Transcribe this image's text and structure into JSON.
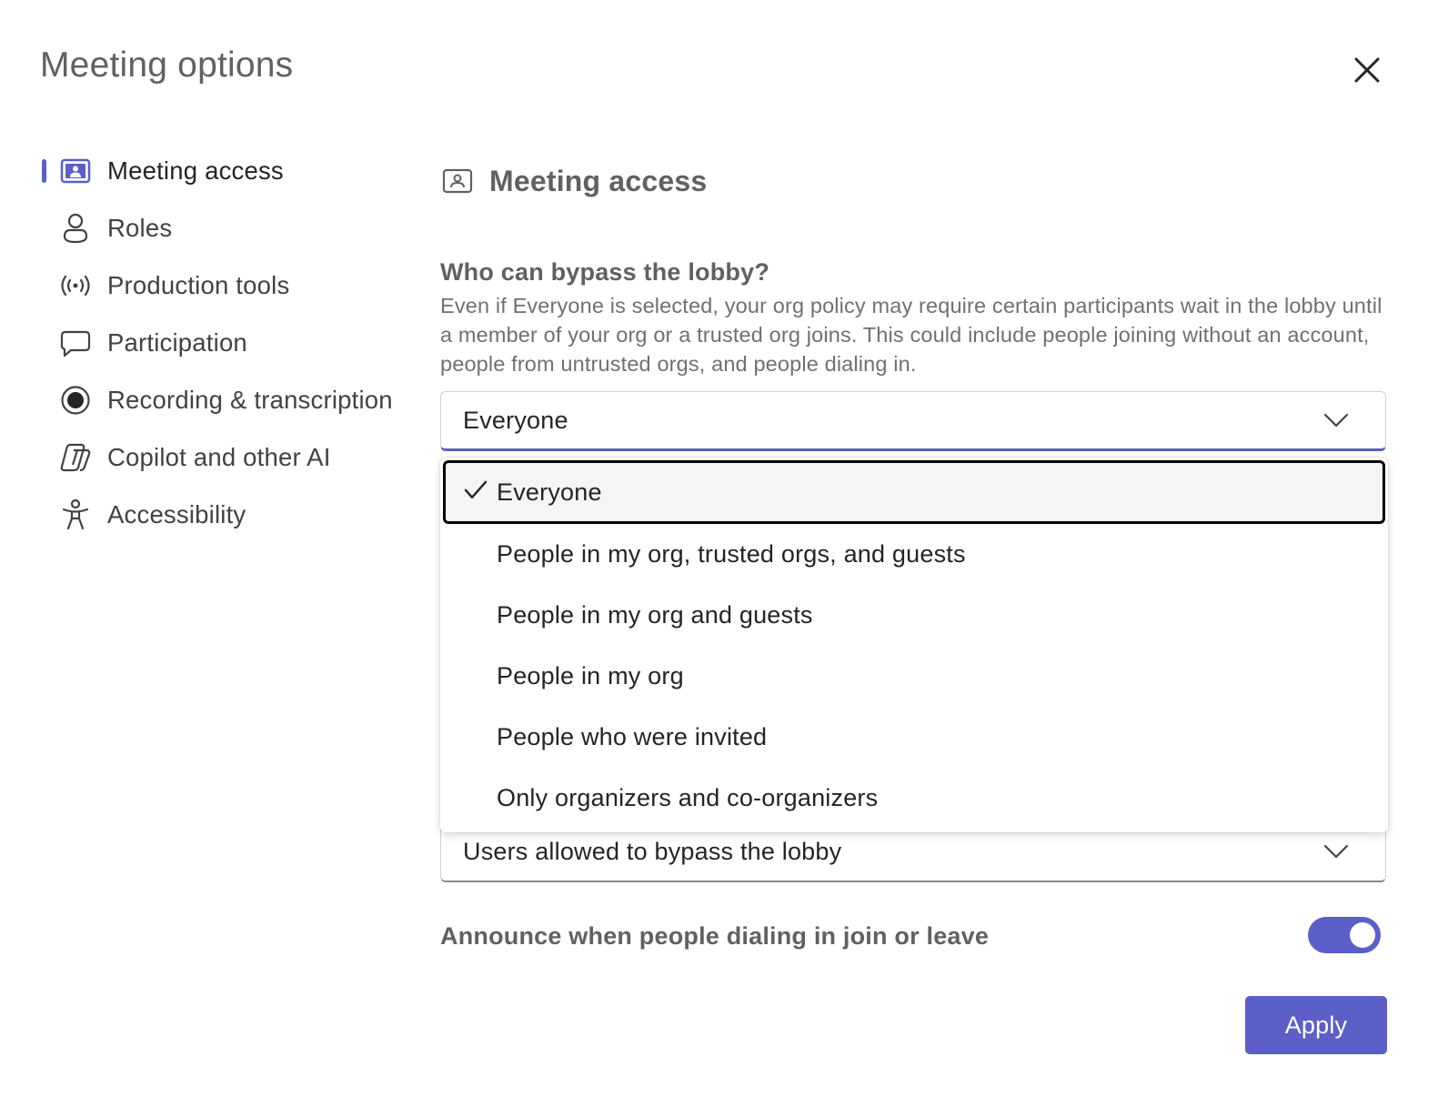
{
  "dialog": {
    "title": "Meeting options",
    "close_icon": "close-icon"
  },
  "sidebar": {
    "active_index": 0,
    "accent_color": "#5b5fc7",
    "items": [
      {
        "label": "Meeting access",
        "icon": "person-card-icon"
      },
      {
        "label": "Roles",
        "icon": "person-icon"
      },
      {
        "label": "Production tools",
        "icon": "broadcast-icon"
      },
      {
        "label": "Participation",
        "icon": "chat-bubble-icon"
      },
      {
        "label": "Recording & transcription",
        "icon": "record-icon"
      },
      {
        "label": "Copilot and other AI",
        "icon": "copilot-icon"
      },
      {
        "label": "Accessibility",
        "icon": "accessibility-icon"
      }
    ]
  },
  "main": {
    "section_title": "Meeting access",
    "section_icon": "person-card-icon",
    "lobby": {
      "question": "Who can bypass the lobby?",
      "description": "Even if Everyone is selected, your org policy may require certain participants wait in the lobby until a member of your org or a trusted org joins. This could include people joining without an account, people from untrusted orgs, and people dialing in.",
      "selected_value": "Everyone",
      "options": [
        "Everyone",
        "People in my org, trusted orgs, and guests",
        "People in my org and guests",
        "People in my org",
        "People who were invited",
        "Only organizers and co-organizers"
      ],
      "selected_index": 0
    },
    "secondary_select": {
      "value": "Users allowed to bypass the lobby"
    },
    "announce": {
      "label": "Announce when people dialing in join or leave",
      "enabled": true
    },
    "apply_label": "Apply"
  }
}
